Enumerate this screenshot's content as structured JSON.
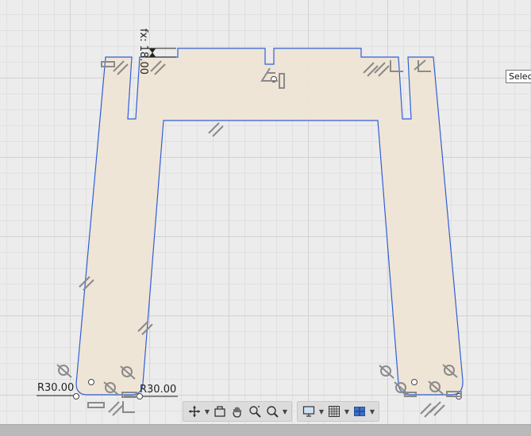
{
  "dimensions": {
    "vertical": "fx: 18.00",
    "radius_left": "R30.00",
    "radius_right": "R30.00"
  },
  "tooltip": {
    "text": "Select"
  },
  "toolbar": {
    "items": [
      {
        "name": "orbit-icon",
        "has_menu": true
      },
      {
        "name": "look-at-icon",
        "has_menu": false
      },
      {
        "name": "pan-icon",
        "has_menu": false
      },
      {
        "name": "zoom-icon",
        "has_menu": false
      },
      {
        "name": "fit-icon",
        "has_menu": true
      },
      {
        "name": "display-settings-icon",
        "has_menu": true
      },
      {
        "name": "grid-snaps-icon",
        "has_menu": true
      },
      {
        "name": "viewports-icon",
        "has_menu": true
      }
    ]
  },
  "colors": {
    "canvas_bg": "#ececec",
    "profile_fill": "#f0e4d4",
    "profile_stroke": "#2f5fd6",
    "constraint_glyph": "#8a8a8a"
  }
}
